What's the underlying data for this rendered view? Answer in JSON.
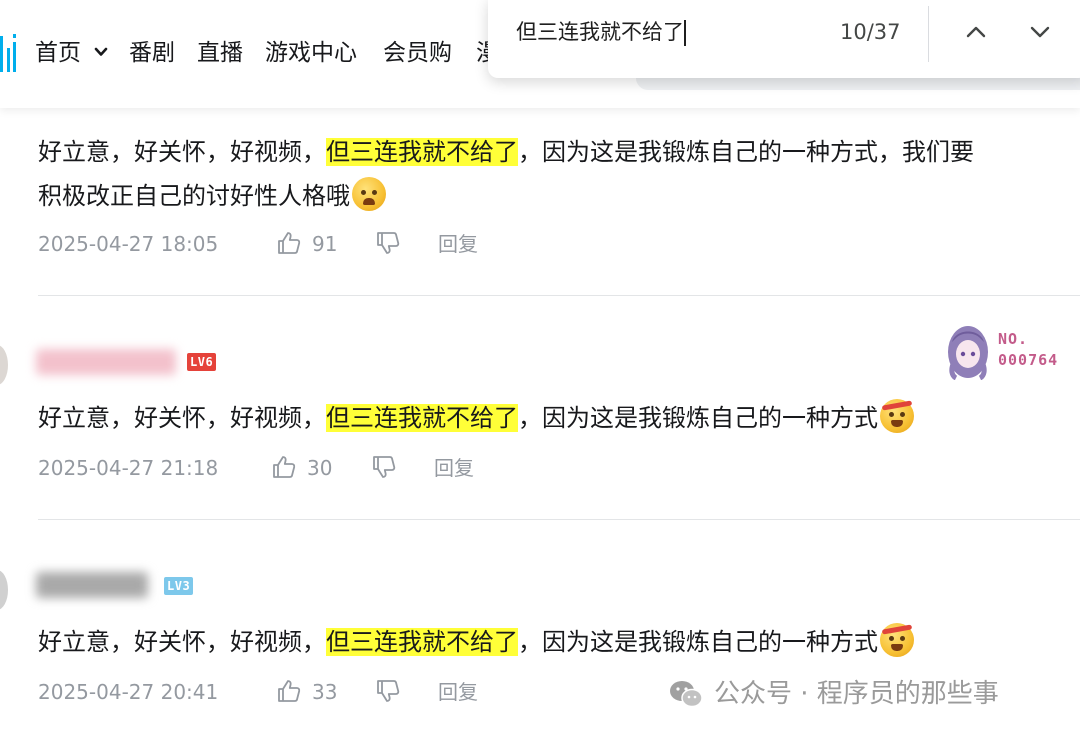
{
  "nav": {
    "items": [
      "首页",
      "番剧",
      "直播",
      "游戏中心",
      "会员购",
      "漫"
    ],
    "accent": "#00aeec"
  },
  "findbar": {
    "query": "但三连我就不给了",
    "count": "10/37"
  },
  "comments": [
    {
      "text_before": "好立意，好关怀，好视频，",
      "highlight": "但三连我就不给了",
      "text_after": "，因为这是我锻炼自己的一种方式，我们要",
      "line2": "积极改正自己的讨好性人格哦",
      "date": "2025-04-27 18:05",
      "likes": "91",
      "reply": "回复"
    },
    {
      "level": "LV6",
      "level_color": "#e5423a",
      "fan_badge_line1": "NO.",
      "fan_badge_line2": "000764",
      "text_before": "好立意，好关怀，好视频，",
      "highlight": "但三连我就不给了",
      "text_after": "，因为这是我锻炼自己的一种方式",
      "date": "2025-04-27 21:18",
      "likes": "30",
      "reply": "回复"
    },
    {
      "level": "LV3",
      "level_color": "#7dc8eb",
      "text_before": "好立意，好关怀，好视频，",
      "highlight": "但三连我就不给了",
      "text_after": "，因为这是我锻炼自己的一种方式",
      "date": "2025-04-27 20:41",
      "likes": "33",
      "reply": "回复"
    }
  ],
  "watermark": "公众号 · 程序员的那些事",
  "highlight_color": "#ffff38"
}
